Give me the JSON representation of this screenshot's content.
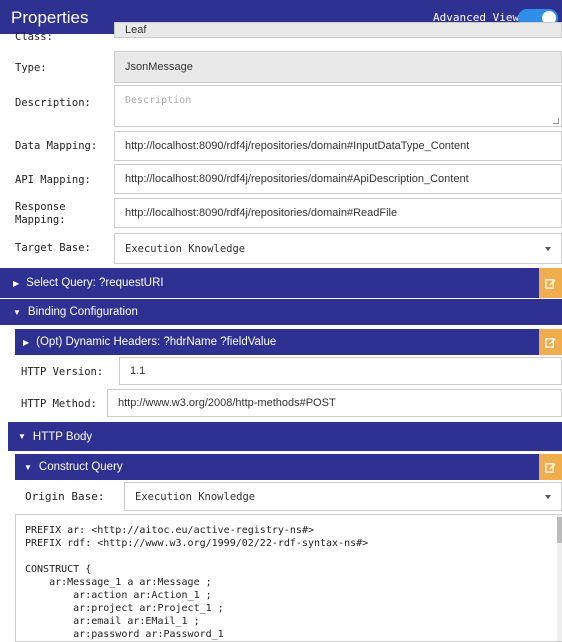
{
  "header": {
    "title": "Properties",
    "advanced_view_label": "Advanced View",
    "advanced_view_on": true
  },
  "form": {
    "class": {
      "label": "Class:",
      "value": "Leaf"
    },
    "type": {
      "label": "Type:",
      "value": "JsonMessage"
    },
    "description": {
      "label": "Description:",
      "placeholder": "Description"
    },
    "data_mapping": {
      "label": "Data Mapping:",
      "value": "http://localhost:8090/rdf4j/repositories/domain#InputDataType_Content"
    },
    "api_mapping": {
      "label": "API Mapping:",
      "value": "http://localhost:8090/rdf4j/repositories/domain#ApiDescription_Content"
    },
    "response_mapping": {
      "label_1": "Response",
      "label_2": "Mapping:",
      "value": "http://localhost:8090/rdf4j/repositories/domain#ReadFile"
    },
    "target_base": {
      "label": "Target Base:",
      "value": "Execution Knowledge"
    }
  },
  "sections": {
    "select_query": "Select Query: ?requestURI",
    "binding_configuration": "Binding Configuration",
    "dynamic_headers": "(Opt) Dynamic Headers: ?hdrName ?fieldValue",
    "http_body": "HTTP Body",
    "construct_query": "Construct Query"
  },
  "binding": {
    "http_version": {
      "label": "HTTP Version:",
      "value": "1.1"
    },
    "http_method": {
      "label": "HTTP Method:",
      "value": "http://www.w3.org/2008/http-methods#POST"
    }
  },
  "construct": {
    "origin_base": {
      "label": "Origin Base:",
      "value": "Execution Knowledge"
    },
    "code_lines": [
      "PREFIX ar: <http://aitoc.eu/active-registry-ns#>",
      "PREFIX rdf: <http://www.w3.org/1999/02/22-rdf-syntax-ns#>",
      "",
      "CONSTRUCT {",
      "    ar:Message_1 a ar:Message ;",
      "        ar:action ar:Action_1 ;",
      "        ar:project ar:Project_1 ;",
      "        ar:email ar:EMail_1 ;",
      "        ar:password ar:Password_1"
    ]
  },
  "colors": {
    "bar": "#2e3192",
    "edit_button": "#f0ad4e",
    "toggle": "#2f8fe8"
  },
  "icons": {
    "edit": "edit-icon",
    "expand": "caret-right-icon",
    "collapse": "caret-down-icon"
  }
}
